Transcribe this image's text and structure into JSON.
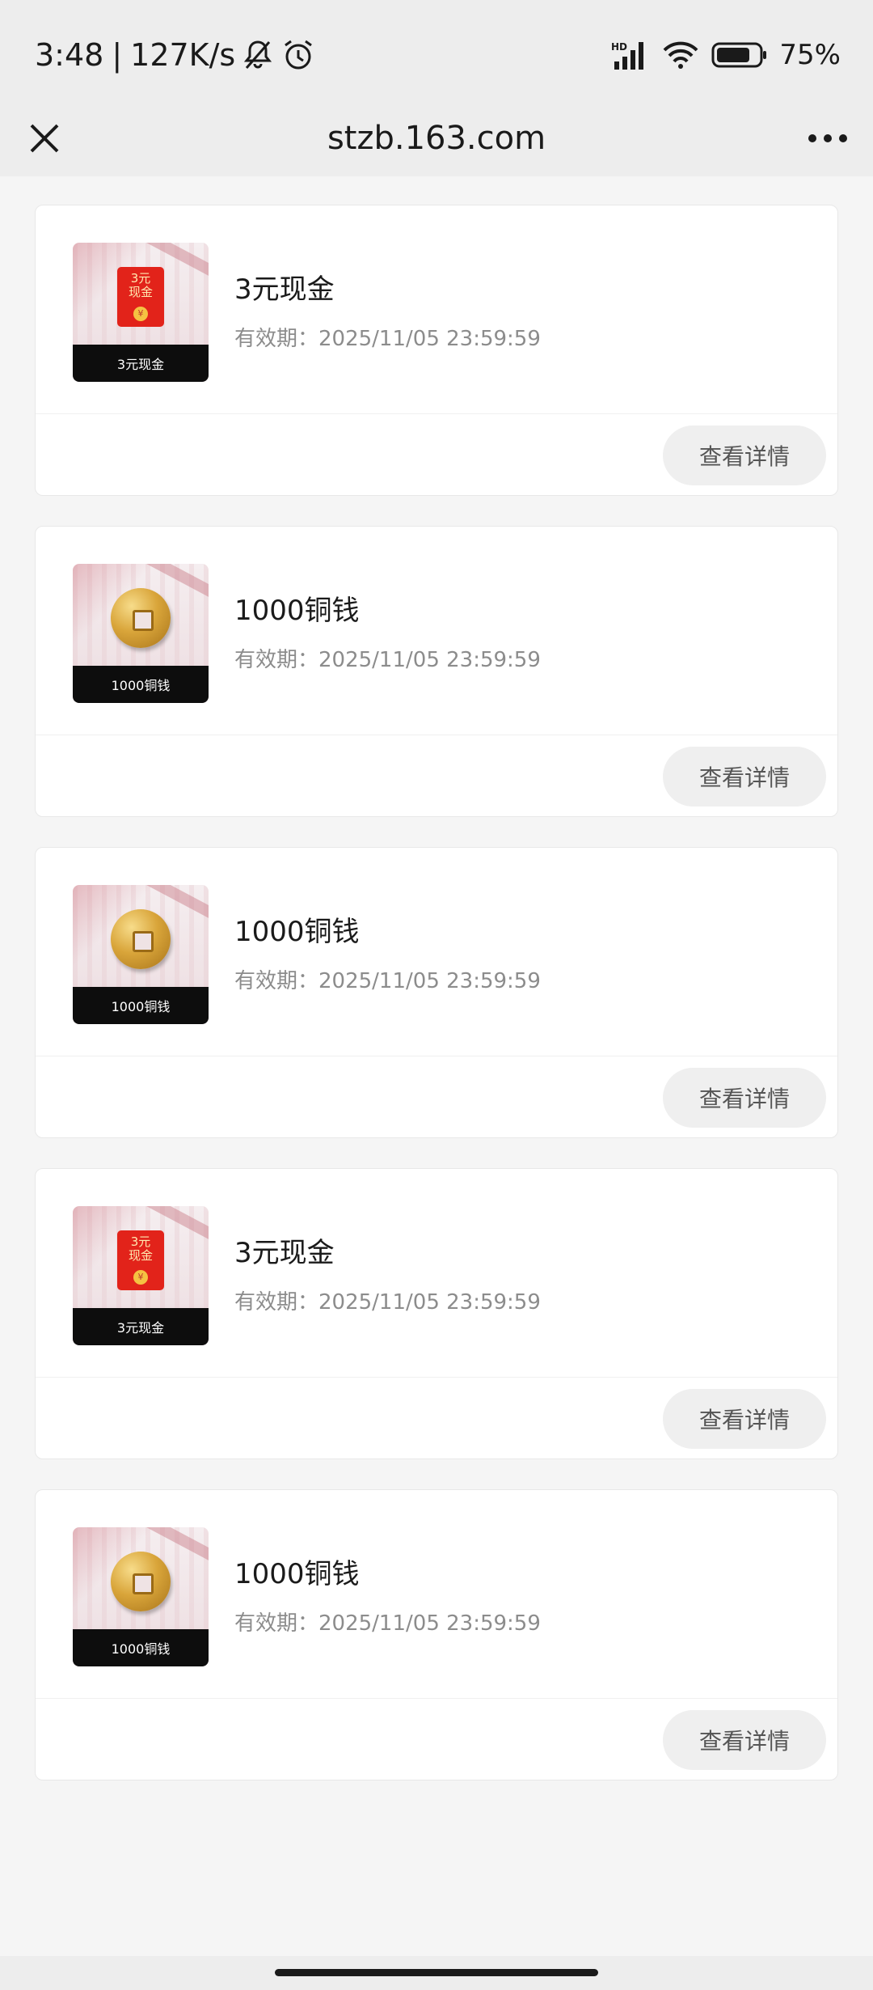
{
  "status_bar": {
    "time": "3:48",
    "separator": "|",
    "speed": "127K/s",
    "network": "HD",
    "battery": "75%",
    "icons": [
      "mute-bell-icon",
      "alarm-icon",
      "signal-icon",
      "wifi-icon",
      "battery-icon"
    ]
  },
  "header": {
    "title": "stzb.163.com",
    "close_icon": "close-icon",
    "more_icon": "more-icon"
  },
  "items": [
    {
      "thumb_type": "red-packet",
      "thumb_text": "3元\n现金",
      "thumb_coin": "¥",
      "thumb_caption": "3元现金",
      "title": "3元现金",
      "expiry": "有效期：2025/11/05 23:59:59",
      "button": "查看详情"
    },
    {
      "thumb_type": "coin",
      "thumb_caption": "1000铜钱",
      "title": "1000铜钱",
      "expiry": "有效期：2025/11/05 23:59:59",
      "button": "查看详情"
    },
    {
      "thumb_type": "coin",
      "thumb_caption": "1000铜钱",
      "title": "1000铜钱",
      "expiry": "有效期：2025/11/05 23:59:59",
      "button": "查看详情"
    },
    {
      "thumb_type": "red-packet",
      "thumb_text": "3元\n现金",
      "thumb_coin": "¥",
      "thumb_caption": "3元现金",
      "title": "3元现金",
      "expiry": "有效期：2025/11/05 23:59:59",
      "button": "查看详情"
    },
    {
      "thumb_type": "coin",
      "thumb_caption": "1000铜钱",
      "title": "1000铜钱",
      "expiry": "有效期：2025/11/05 23:59:59",
      "button": "查看详情"
    }
  ],
  "colors": {
    "background": "#f5f5f5",
    "header": "#ededed",
    "card": "#ffffff",
    "red_packet": "#e2231a",
    "muted_text": "#8c8c8c"
  }
}
